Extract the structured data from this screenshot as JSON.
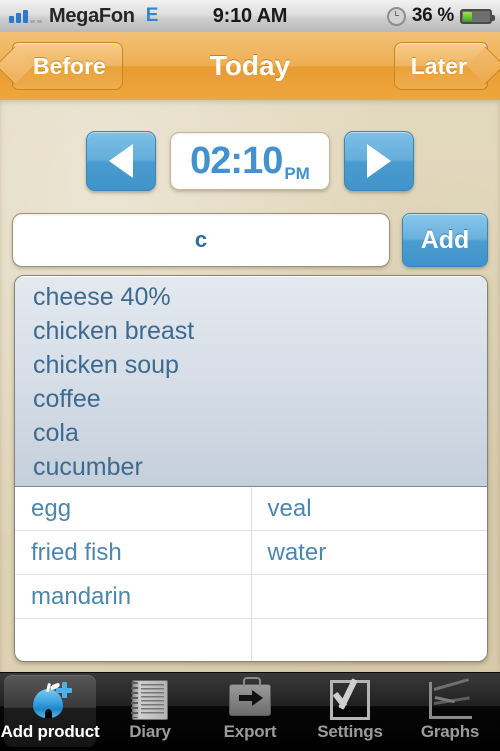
{
  "status_bar": {
    "carrier": "MegaFon",
    "network_type": "E",
    "time": "9:10 AM",
    "battery_percent": "36 %",
    "battery_level": 36,
    "signal_bars_filled": 3,
    "signal_bars_total": 5,
    "alarm_icon": "clock-icon"
  },
  "nav_bar": {
    "back_label": "Before",
    "title": "Today",
    "forward_label": "Later",
    "accent": "#eda73f"
  },
  "time_stepper": {
    "prev_icon": "triangle-left-icon",
    "next_icon": "triangle-right-icon",
    "time": "02:10",
    "meridiem": "PM",
    "accent": "#4391ce"
  },
  "search": {
    "value": "c",
    "placeholder": "",
    "add_label": "Add"
  },
  "suggestions": [
    "cheese 40%",
    "chicken breast",
    "chicken soup",
    "coffee",
    "cola",
    "cucumber"
  ],
  "product_table": {
    "rows": [
      {
        "left": "egg",
        "right": "veal"
      },
      {
        "left": "fried fish",
        "right": "water"
      },
      {
        "left": "mandarin",
        "right": ""
      },
      {
        "left": "",
        "right": ""
      }
    ]
  },
  "tab_bar": {
    "items": [
      {
        "label": "Add product",
        "icon": "apple-plus-icon",
        "selected": true
      },
      {
        "label": "Diary",
        "icon": "notebook-icon",
        "selected": false
      },
      {
        "label": "Export",
        "icon": "briefcase-arrow-icon",
        "selected": false
      },
      {
        "label": "Settings",
        "icon": "checkmark-box-icon",
        "selected": false
      },
      {
        "label": "Graphs",
        "icon": "line-chart-icon",
        "selected": false
      }
    ]
  }
}
